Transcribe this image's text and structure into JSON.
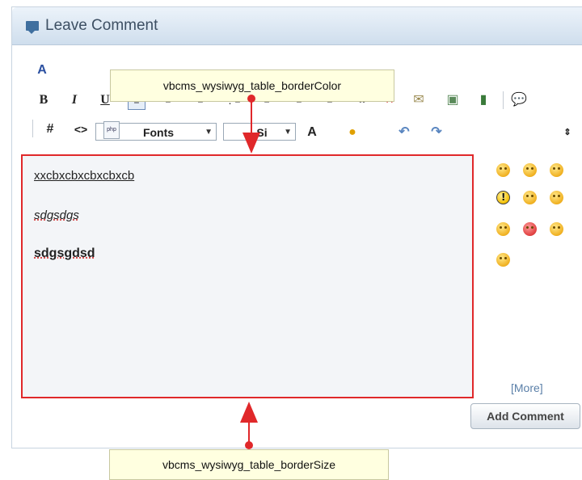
{
  "panel": {
    "title": "Leave Comment"
  },
  "toolbar": {
    "font_select": "Fonts",
    "size_select": "Si",
    "bold": "B",
    "italic": "I",
    "underline": "U",
    "hash": "#",
    "code": "<>",
    "php": "php"
  },
  "editor": {
    "line1": "xxcbxcbxcbxcbxcb",
    "line2": "sdgsdgs",
    "line3": "sdgsgdsd"
  },
  "smilies": {
    "more_link": "[More]"
  },
  "actions": {
    "add_comment": "Add Comment"
  },
  "annotations": {
    "top": "vbcms_wysiwyg_table_borderColor",
    "bottom": "vbcms_wysiwyg_table_borderSize"
  },
  "colors": {
    "highlight": "#e0282a",
    "header": "#cfdeed",
    "callout": "#ffffe0"
  }
}
